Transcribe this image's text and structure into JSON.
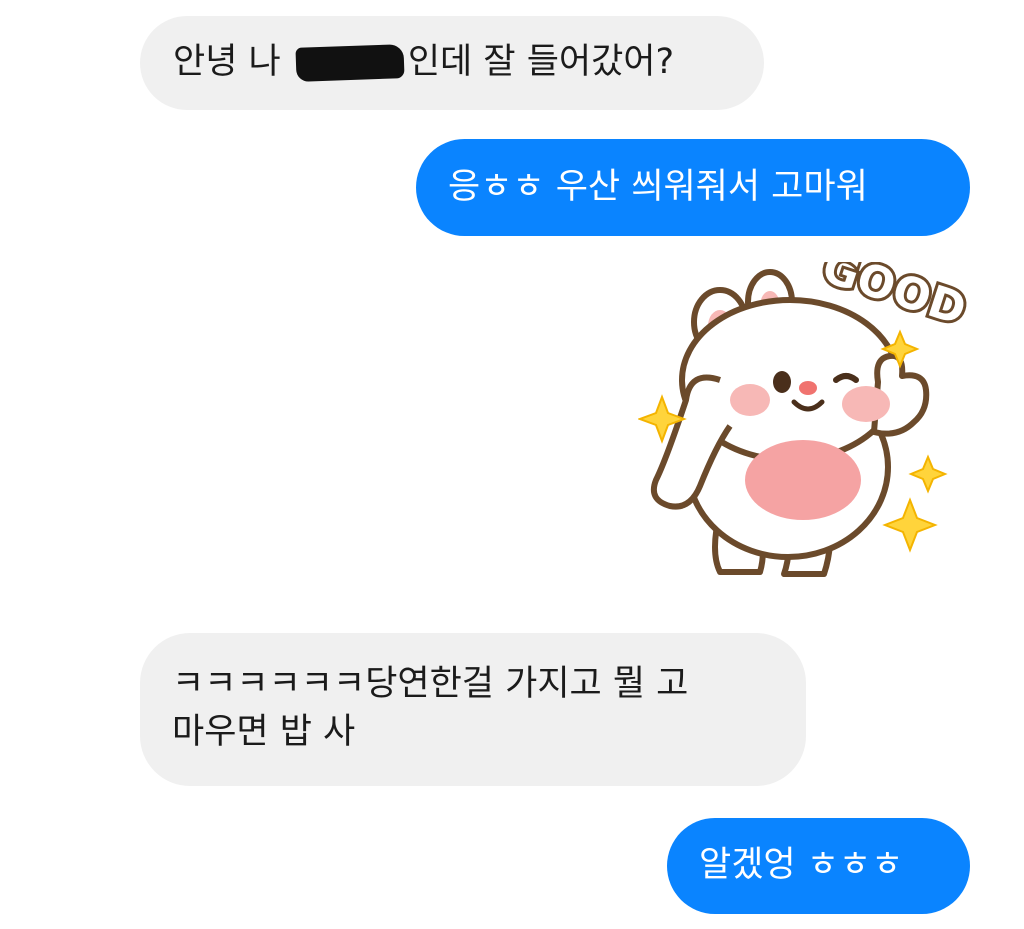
{
  "messages": [
    {
      "side": "incoming",
      "text_before": "안녕 나 ",
      "text_after": "인데 잘 들어갔어?",
      "redacted": true
    },
    {
      "side": "outgoing",
      "text": "응ㅎㅎ 우산 씌워줘서 고마워"
    },
    {
      "side": "outgoing",
      "sticker_text": "GOOD",
      "sticker_icon": "bunny-good-sticker"
    },
    {
      "side": "incoming",
      "line1": "ㅋㅋㅋㅋㅋㅋ당연한걸 가지고 뭘 고",
      "line2": "마우면 밥 사"
    },
    {
      "side": "outgoing",
      "text": "알겠엉 ㅎㅎㅎ"
    }
  ],
  "colors": {
    "outgoing_bubble": "#0a84ff",
    "incoming_bubble": "#f0f0f0",
    "incoming_text": "#1b1b1b",
    "outgoing_text": "#ffffff"
  }
}
